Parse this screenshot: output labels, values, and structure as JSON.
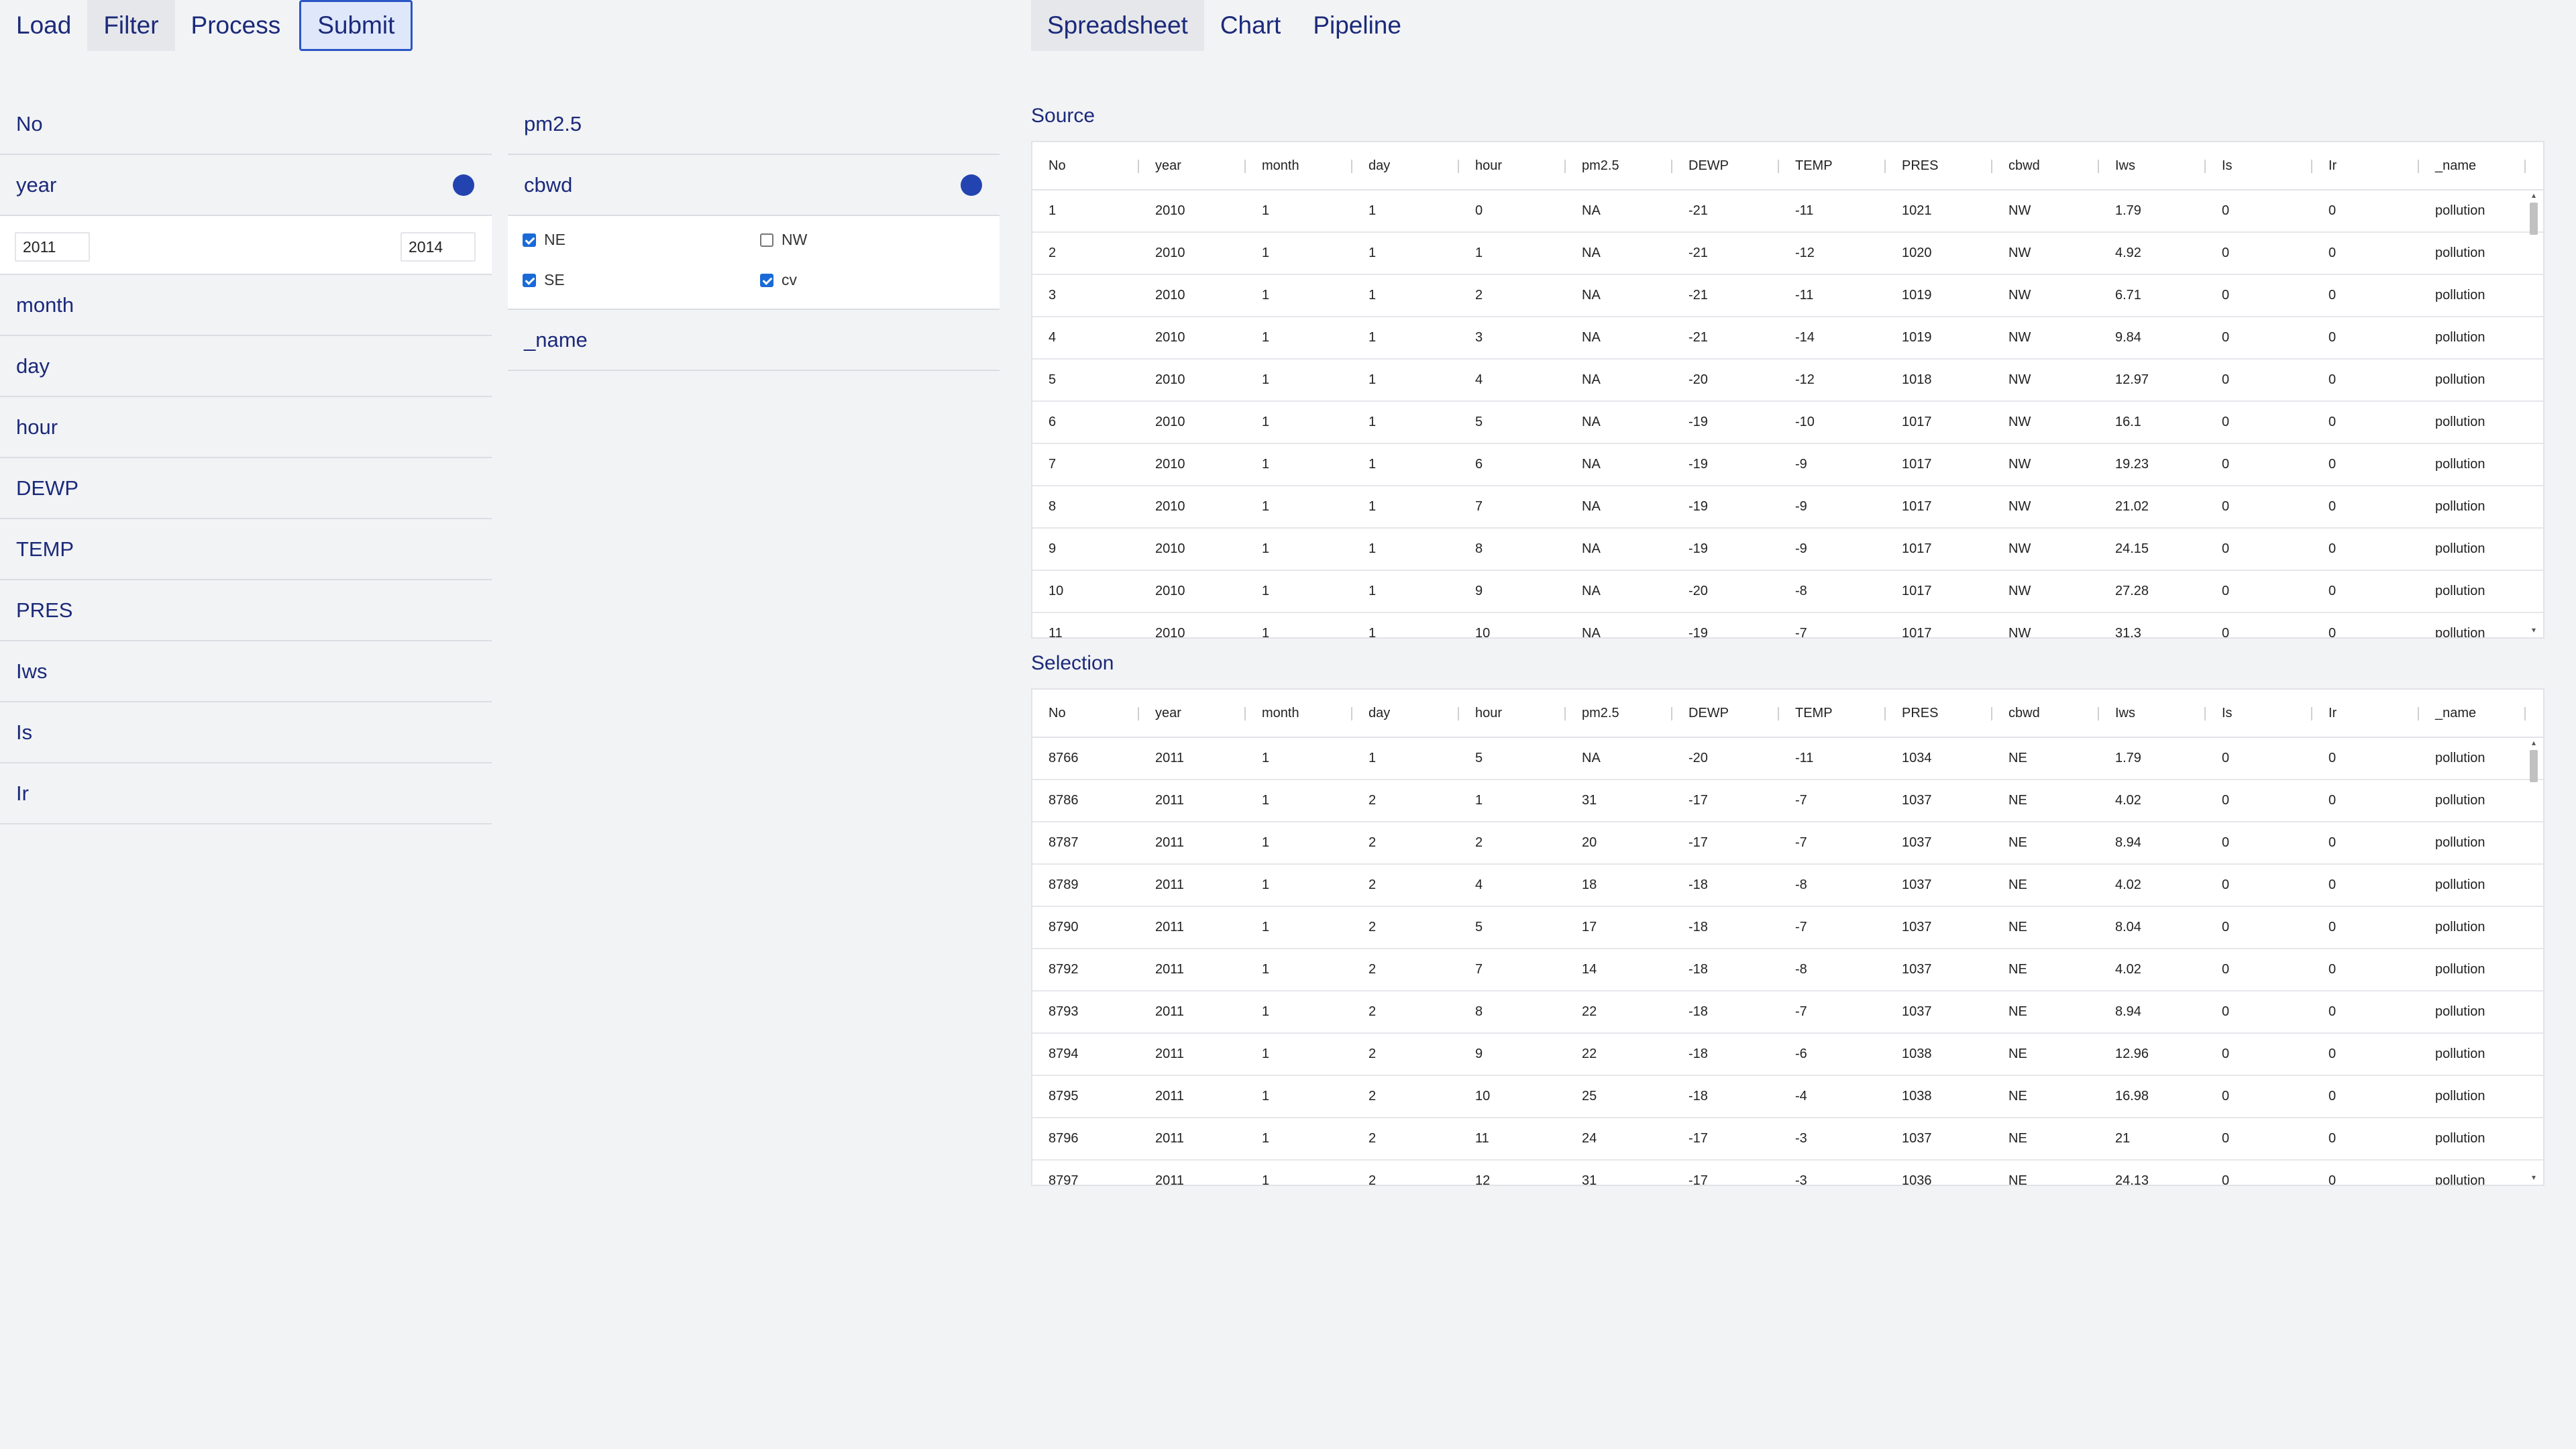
{
  "left_tabs": [
    {
      "label": "Load"
    },
    {
      "label": "Filter"
    },
    {
      "label": "Process"
    },
    {
      "label": "Submit"
    }
  ],
  "right_tabs": [
    {
      "label": "Spreadsheet"
    },
    {
      "label": "Chart"
    },
    {
      "label": "Pipeline"
    }
  ],
  "filters_col1": {
    "no": "No",
    "year": "year",
    "year_from": "2011",
    "year_to": "2014",
    "month": "month",
    "day": "day",
    "hour": "hour",
    "dewp": "DEWP",
    "temp": "TEMP",
    "pres": "PRES",
    "iws": "Iws",
    "is": "Is",
    "ir": "Ir"
  },
  "filters_col2": {
    "pm25": "pm2.5",
    "cbwd": "cbwd",
    "cb_ne": "NE",
    "cb_nw": "NW",
    "cb_se": "SE",
    "cb_cv": "cv",
    "name": "_name"
  },
  "colors": {
    "accent": "#2344b0",
    "checkbox": "#1a6ad7",
    "text": "#1b2a7a"
  },
  "columns": [
    "No",
    "year",
    "month",
    "day",
    "hour",
    "pm2.5",
    "DEWP",
    "TEMP",
    "PRES",
    "cbwd",
    "Iws",
    "Is",
    "Ir",
    "_name"
  ],
  "source": {
    "title": "Source",
    "rows": [
      [
        "1",
        "2010",
        "1",
        "1",
        "0",
        "NA",
        "-21",
        "-11",
        "1021",
        "NW",
        "1.79",
        "0",
        "0",
        "pollution"
      ],
      [
        "2",
        "2010",
        "1",
        "1",
        "1",
        "NA",
        "-21",
        "-12",
        "1020",
        "NW",
        "4.92",
        "0",
        "0",
        "pollution"
      ],
      [
        "3",
        "2010",
        "1",
        "1",
        "2",
        "NA",
        "-21",
        "-11",
        "1019",
        "NW",
        "6.71",
        "0",
        "0",
        "pollution"
      ],
      [
        "4",
        "2010",
        "1",
        "1",
        "3",
        "NA",
        "-21",
        "-14",
        "1019",
        "NW",
        "9.84",
        "0",
        "0",
        "pollution"
      ],
      [
        "5",
        "2010",
        "1",
        "1",
        "4",
        "NA",
        "-20",
        "-12",
        "1018",
        "NW",
        "12.97",
        "0",
        "0",
        "pollution"
      ],
      [
        "6",
        "2010",
        "1",
        "1",
        "5",
        "NA",
        "-19",
        "-10",
        "1017",
        "NW",
        "16.1",
        "0",
        "0",
        "pollution"
      ],
      [
        "7",
        "2010",
        "1",
        "1",
        "6",
        "NA",
        "-19",
        "-9",
        "1017",
        "NW",
        "19.23",
        "0",
        "0",
        "pollution"
      ],
      [
        "8",
        "2010",
        "1",
        "1",
        "7",
        "NA",
        "-19",
        "-9",
        "1017",
        "NW",
        "21.02",
        "0",
        "0",
        "pollution"
      ],
      [
        "9",
        "2010",
        "1",
        "1",
        "8",
        "NA",
        "-19",
        "-9",
        "1017",
        "NW",
        "24.15",
        "0",
        "0",
        "pollution"
      ],
      [
        "10",
        "2010",
        "1",
        "1",
        "9",
        "NA",
        "-20",
        "-8",
        "1017",
        "NW",
        "27.28",
        "0",
        "0",
        "pollution"
      ],
      [
        "11",
        "2010",
        "1",
        "1",
        "10",
        "NA",
        "-19",
        "-7",
        "1017",
        "NW",
        "31.3",
        "0",
        "0",
        "pollution"
      ]
    ]
  },
  "selection": {
    "title": "Selection",
    "rows": [
      [
        "8766",
        "2011",
        "1",
        "1",
        "5",
        "NA",
        "-20",
        "-11",
        "1034",
        "NE",
        "1.79",
        "0",
        "0",
        "pollution"
      ],
      [
        "8786",
        "2011",
        "1",
        "2",
        "1",
        "31",
        "-17",
        "-7",
        "1037",
        "NE",
        "4.02",
        "0",
        "0",
        "pollution"
      ],
      [
        "8787",
        "2011",
        "1",
        "2",
        "2",
        "20",
        "-17",
        "-7",
        "1037",
        "NE",
        "8.94",
        "0",
        "0",
        "pollution"
      ],
      [
        "8789",
        "2011",
        "1",
        "2",
        "4",
        "18",
        "-18",
        "-8",
        "1037",
        "NE",
        "4.02",
        "0",
        "0",
        "pollution"
      ],
      [
        "8790",
        "2011",
        "1",
        "2",
        "5",
        "17",
        "-18",
        "-7",
        "1037",
        "NE",
        "8.04",
        "0",
        "0",
        "pollution"
      ],
      [
        "8792",
        "2011",
        "1",
        "2",
        "7",
        "14",
        "-18",
        "-8",
        "1037",
        "NE",
        "4.02",
        "0",
        "0",
        "pollution"
      ],
      [
        "8793",
        "2011",
        "1",
        "2",
        "8",
        "22",
        "-18",
        "-7",
        "1037",
        "NE",
        "8.94",
        "0",
        "0",
        "pollution"
      ],
      [
        "8794",
        "2011",
        "1",
        "2",
        "9",
        "22",
        "-18",
        "-6",
        "1038",
        "NE",
        "12.96",
        "0",
        "0",
        "pollution"
      ],
      [
        "8795",
        "2011",
        "1",
        "2",
        "10",
        "25",
        "-18",
        "-4",
        "1038",
        "NE",
        "16.98",
        "0",
        "0",
        "pollution"
      ],
      [
        "8796",
        "2011",
        "1",
        "2",
        "11",
        "24",
        "-17",
        "-3",
        "1037",
        "NE",
        "21",
        "0",
        "0",
        "pollution"
      ],
      [
        "8797",
        "2011",
        "1",
        "2",
        "12",
        "31",
        "-17",
        "-3",
        "1036",
        "NE",
        "24.13",
        "0",
        "0",
        "pollution"
      ]
    ]
  }
}
